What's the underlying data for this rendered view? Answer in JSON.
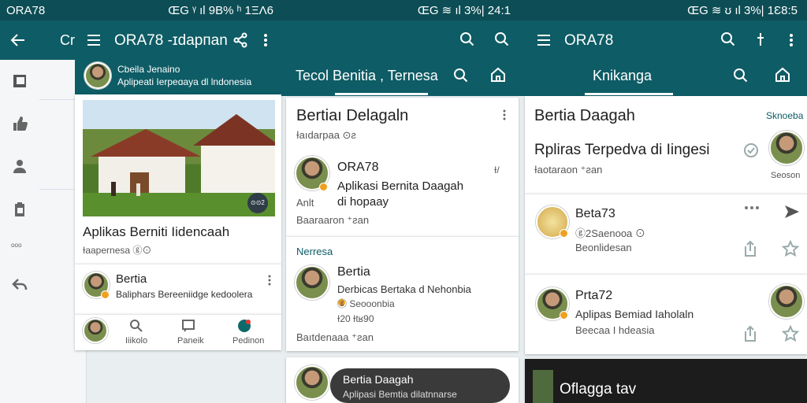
{
  "status": {
    "left_title": "ORA78",
    "p1_info": "ŒG ᵞ ıl 9B% ʰ 1ΞΛ6",
    "p2_info": "ŒG ≋ ıl 3%| 24:1",
    "p3_info": "ŒG ≋ ʊ ıl 3%| 1Ɛ8:5"
  },
  "panel0": {
    "title_partial": "Cr",
    "sidebar_icons": [
      "image-icon",
      "thumb-up-icon",
      "people-icon",
      "clipboard-icon",
      "more-icon",
      "reply-icon"
    ],
    "more_text": "ᵒᵒᵒ"
  },
  "panel1": {
    "title": "ORA78 -ɪdapпan",
    "profile": {
      "name": "Cbeila Jenaino",
      "subtitle": "Aplipeati Ierpeɑaya dl lndonesia"
    },
    "featured": {
      "title": "Aplikas Berniti Iidencaah",
      "meta": "Ɨaapernesa ⓖ⊙",
      "badge": "⊙⊙2"
    },
    "item": {
      "name": "Bertia",
      "text": "Baliphars Bereeniidge kedoolera"
    },
    "nav": [
      {
        "label": "Iiikolo",
        "icon": "search-icon"
      },
      {
        "label": "Paneik",
        "icon": "message-icon"
      },
      {
        "label": "Pedinon",
        "icon": "notification-icon"
      }
    ]
  },
  "panel2": {
    "tab_label": "Tecol Benitia , Ternesa",
    "card1": {
      "title": "Bertiaı Delagaln",
      "meta": "Ɨaıdarpaa ⊙ƨ",
      "author": "ORA78",
      "text": "Aplikasi Bernita Daagah di hopaay",
      "anl": "Anlt",
      "footer": "Baaraaron ⁺ƨan",
      "side_icon": "Ɨ/"
    },
    "card2": {
      "section": "Nerresa",
      "name": "Bertia",
      "text": "Derbicas Bertaka d Nehonbia",
      "sub": "ⓖ Seooonbia",
      "nums": "Ɨ20 Ɨtʁ90",
      "footer": "Baıtdenaaa ⁺ƨan"
    },
    "card3": {
      "name": "Bertia Daagah",
      "text": "Aplipasi Bemtia dilatnnarse"
    }
  },
  "panel3": {
    "title": "ORA78",
    "tab_label": "Knikanga",
    "header": {
      "title": "Bertia Daagah",
      "section": "Sknoeba"
    },
    "featured": {
      "title": "Rpliras Terpedva di Iingesi",
      "meta": "Ɨaotaraon ⁺ƨan",
      "side": "Seoson"
    },
    "item1": {
      "name": "Beta73",
      "sub": "ⓖ2Saenooa ⊙",
      "meta": "Beonlidesan"
    },
    "item2": {
      "name": "Prta72",
      "sub": "Aplipas Bemiad Iaholaln",
      "meta": "Beecaa I hdeasia"
    },
    "bottom": "Oflagga tav"
  }
}
